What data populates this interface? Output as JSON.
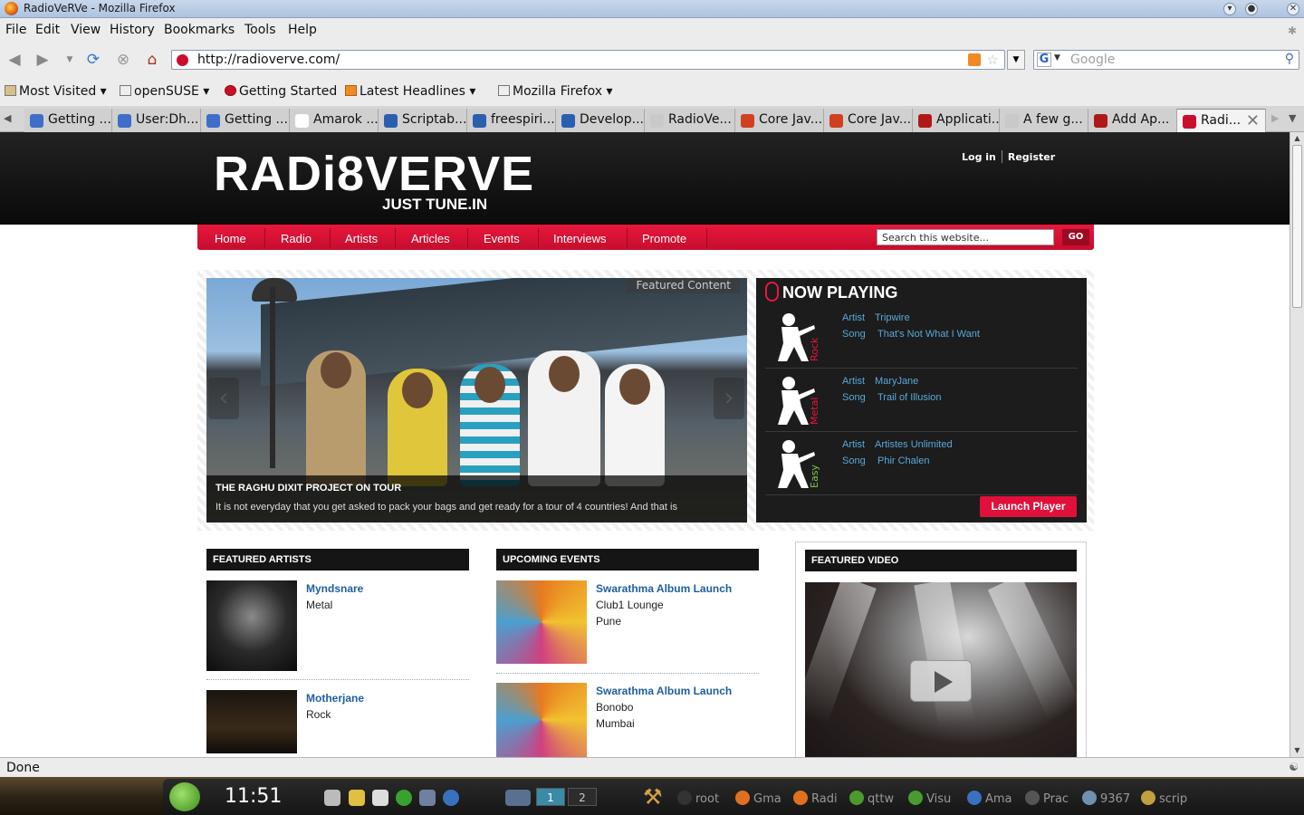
{
  "window": {
    "title": "RadioVeRVe - Mozilla Firefox"
  },
  "menu": [
    "File",
    "Edit",
    "View",
    "History",
    "Bookmarks",
    "Tools",
    "Help"
  ],
  "url": "http://radioverve.com/",
  "search_placeholder": "Google",
  "bookmarks": [
    {
      "label": "Most Visited",
      "dropdown": true
    },
    {
      "label": "openSUSE",
      "dropdown": true
    },
    {
      "label": "Getting Started",
      "dropdown": false
    },
    {
      "label": "Latest Headlines",
      "dropdown": true
    },
    {
      "label": "Mozilla Firefox",
      "dropdown": true
    }
  ],
  "tabs": [
    {
      "label": "Getting ...",
      "icon_color": "#3f6ec8"
    },
    {
      "label": "User:Dh...",
      "icon_color": "#3f6ec8"
    },
    {
      "label": "Getting ...",
      "icon_color": "#3f6ec8"
    },
    {
      "label": "Amarok ...",
      "icon_color": "#ffffff"
    },
    {
      "label": "Scriptab...",
      "icon_color": "#2a5fb0"
    },
    {
      "label": "freespiri...",
      "icon_color": "#2a5fb0"
    },
    {
      "label": "Develop...",
      "icon_color": "#2a5fb0"
    },
    {
      "label": "RadioVe...",
      "icon_color": "#c9c9c9"
    },
    {
      "label": "Core Jav...",
      "icon_color": "#d04020"
    },
    {
      "label": "Core Jav...",
      "icon_color": "#d04020"
    },
    {
      "label": "Applicati...",
      "icon_color": "#b01818"
    },
    {
      "label": "A few g...",
      "icon_color": "#c9c9c9"
    },
    {
      "label": "Add Ap...",
      "icon_color": "#b01818"
    },
    {
      "label": "Radi...",
      "icon_color": "#c8102e"
    }
  ],
  "site": {
    "logo": "RADi8VERVE",
    "tagline": "JUST TUNE.IN",
    "login": "Log in",
    "register": "Register",
    "nav": [
      "Home",
      "Radio",
      "Artists",
      "Articles",
      "Events",
      "Interviews",
      "Promote"
    ],
    "search_value": "Search this website...",
    "go": "GO",
    "featured_tag": "Featured Content",
    "slide_title": "THE RAGHU DIXIT PROJECT ON TOUR",
    "slide_text": "It is not everyday that you get asked to pack your bags and get ready for a tour of 4 countries! And that is",
    "now_playing": {
      "heading": "NOW PLAYING",
      "artist_label": "Artist",
      "song_label": "Song",
      "rows": [
        {
          "genre": "Rock",
          "genre_color": "#e8173c",
          "artist": "Tripwire",
          "song": "That's Not What I Want"
        },
        {
          "genre": "Metal",
          "genre_color": "#e8173c",
          "artist": "MaryJane",
          "song": "Trail of Illusion"
        },
        {
          "genre": "Easy",
          "genre_color": "#7ec850",
          "artist": "Artistes Unlimited",
          "song": "Phir Chalen"
        }
      ],
      "launch": "Launch Player"
    },
    "featured_artists": {
      "heading": "FEATURED ARTISTS",
      "items": [
        {
          "name": "Myndsnare",
          "genre": "Metal"
        },
        {
          "name": "Motherjane",
          "genre": "Rock"
        }
      ]
    },
    "upcoming_events": {
      "heading": "UPCOMING EVENTS",
      "items": [
        {
          "name": "Swarathma Album Launch",
          "venue": "Club1 Lounge",
          "city": "Pune"
        },
        {
          "name": "Swarathma Album Launch",
          "venue": "Bonobo",
          "city": "Mumbai"
        }
      ]
    },
    "featured_video": {
      "heading": "FEATURED VIDEO"
    }
  },
  "status": "Done",
  "taskbar": {
    "clock": "11:51",
    "pager": [
      "1",
      "2"
    ],
    "tasks": [
      {
        "label": "root",
        "icon_color": "#333333"
      },
      {
        "label": "Gma",
        "icon_color": "#e07020"
      },
      {
        "label": "Radi",
        "icon_color": "#e07020"
      },
      {
        "label": "qttw",
        "icon_color": "#4a9a30"
      },
      {
        "label": "Visu",
        "icon_color": "#4a9a30"
      },
      {
        "label": "Ama",
        "icon_color": "#3a70c0"
      },
      {
        "label": "Prac",
        "icon_color": "#555555"
      },
      {
        "label": "9367",
        "icon_color": "#7090b0"
      },
      {
        "label": "scrip",
        "icon_color": "#c0a040"
      }
    ]
  }
}
